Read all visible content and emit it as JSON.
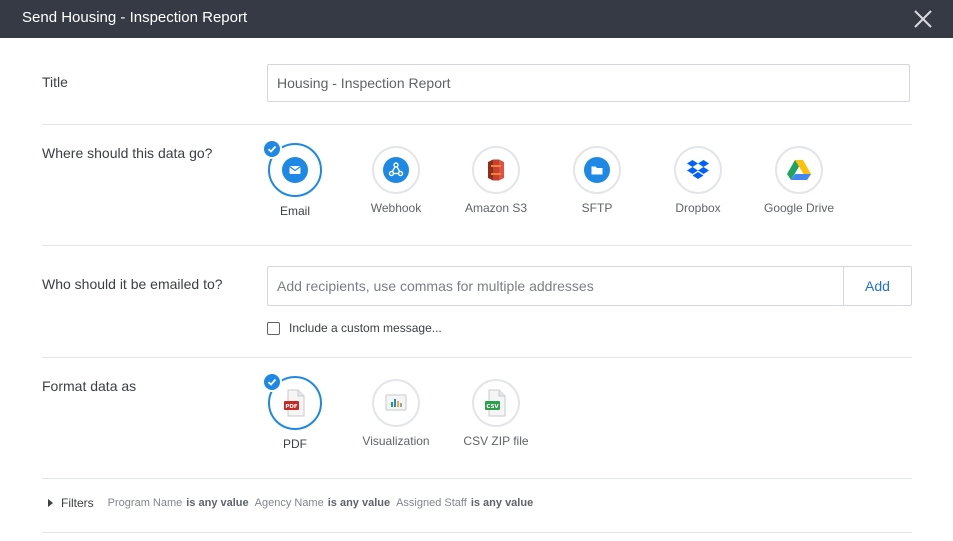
{
  "dialog": {
    "title": "Send Housing - Inspection Report"
  },
  "title_field": {
    "label": "Title",
    "value": "Housing - Inspection Report"
  },
  "destination": {
    "label": "Where should this data go?",
    "options": [
      {
        "label": "Email",
        "selected": true,
        "icon": "email-icon"
      },
      {
        "label": "Webhook",
        "selected": false,
        "icon": "webhook-icon"
      },
      {
        "label": "Amazon S3",
        "selected": false,
        "icon": "amazon-s3-icon"
      },
      {
        "label": "SFTP",
        "selected": false,
        "icon": "sftp-icon"
      },
      {
        "label": "Dropbox",
        "selected": false,
        "icon": "dropbox-icon"
      },
      {
        "label": "Google Drive",
        "selected": false,
        "icon": "google-drive-icon"
      }
    ]
  },
  "recipients": {
    "label": "Who should it be emailed to?",
    "placeholder": "Add recipients, use commas for multiple addresses",
    "value": "",
    "add_label": "Add",
    "custom_message_label": "Include a custom message...",
    "custom_message_checked": false
  },
  "format": {
    "label": "Format data as",
    "options": [
      {
        "label": "PDF",
        "selected": true,
        "icon": "pdf-file-icon",
        "badge": "PDF"
      },
      {
        "label": "Visualization",
        "selected": false,
        "icon": "visualization-icon"
      },
      {
        "label": "CSV ZIP file",
        "selected": false,
        "icon": "csv-file-icon",
        "badge": "CSV"
      }
    ]
  },
  "filters": {
    "label": "Filters",
    "items": [
      {
        "name": "Program Name",
        "value": "is any value"
      },
      {
        "name": "Agency Name",
        "value": "is any value"
      },
      {
        "name": "Assigned Staff",
        "value": "is any value"
      }
    ]
  },
  "colors": {
    "titlebar": "#363a45",
    "accent": "#1e88e5",
    "link": "#1e6fd9"
  }
}
